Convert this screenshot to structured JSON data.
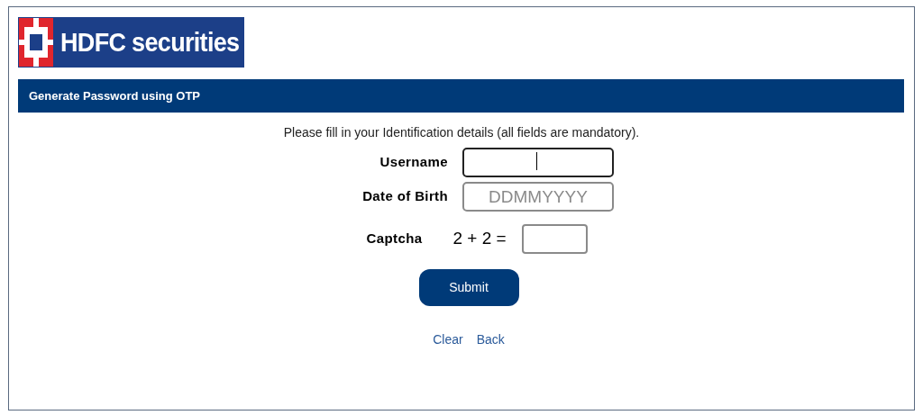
{
  "logo": {
    "text": "HDFC securities"
  },
  "header": {
    "title": "Generate Password using OTP"
  },
  "instructions": "Please fill in your Identification details (all fields are mandatory).",
  "fields": [
    {
      "kind": "text",
      "label": "Username",
      "focused": true
    },
    {
      "kind": "text",
      "label": "Date of Birth",
      "placeholder": "DDMMYYYY",
      "focused": false
    },
    {
      "kind": "captcha",
      "label": "Captcha",
      "question": "2 + 2 =",
      "focused": false
    }
  ],
  "submit": "Submit",
  "links": [
    "Clear",
    "Back"
  ]
}
